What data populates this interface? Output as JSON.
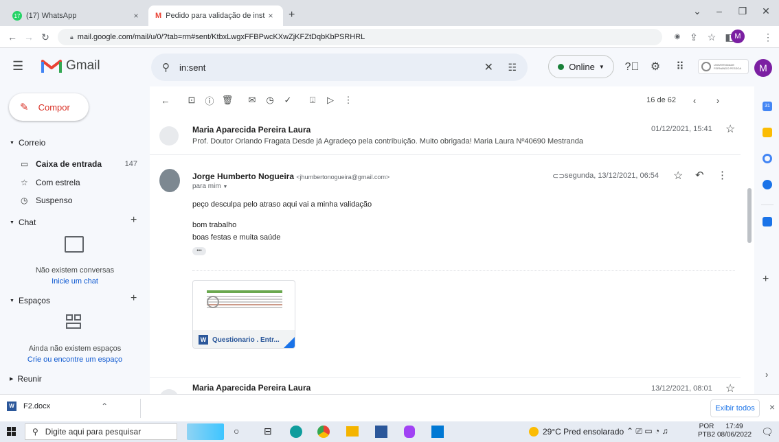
{
  "browser": {
    "tabs": [
      {
        "badge": "17",
        "label": "(17) WhatsApp",
        "close": "×"
      },
      {
        "label": "Pedido para validação de instrum",
        "close": "×"
      }
    ],
    "new_tab": "+",
    "url": "mail.google.com/mail/u/0/?tab=rm#sent/KtbxLwgxFFBPwcKXwZjKFZtDqbKbPSRHRL",
    "profile_initial": "M"
  },
  "gmail": {
    "logo_text": "Gmail",
    "search_value": "in:sent",
    "status": "Online",
    "account_initial": "M",
    "org_label": "UNIVERSIDADE FERNANDO PESSOA"
  },
  "sidebar": {
    "compose": "Compor",
    "mail_section": "Correio",
    "items": [
      {
        "label": "Caixa de entrada",
        "count": "147"
      },
      {
        "label": "Com estrela"
      },
      {
        "label": "Suspenso"
      }
    ],
    "chat_section": "Chat",
    "chat_empty": "Não existem conversas",
    "chat_link": "Inicie um chat",
    "spaces_section": "Espaços",
    "spaces_empty": "Ainda não existem espaços",
    "spaces_link": "Crie ou encontre um espaço",
    "meet_section": "Reunir"
  },
  "toolbar": {
    "counter": "16 de 62"
  },
  "messages": [
    {
      "sender": "Maria Aparecida Pereira Laura",
      "date": "01/12/2021, 15:41",
      "snippet": "Prof. Doutor Orlando Fragata Desde já Agradeço pela contribuição. Muito obrigada! Maria Laura Nº40690 Mestranda"
    },
    {
      "sender": "Jorge Humberto Nogueira",
      "email": "<jhumbertonogueira@gmail.com>",
      "date": "segunda, 13/12/2021, 06:54",
      "to": "para mim",
      "body": [
        "peço desculpa pelo atraso aqui vai a minha validação",
        "bom trabalho",
        "boas festas e muita saúde"
      ],
      "ellipsis": "•••",
      "attachment": "Questionario . Entr..."
    },
    {
      "sender": "Maria Aparecida Pereira Laura",
      "date": "13/12/2021, 08:01"
    }
  ],
  "download_bar": {
    "file": "F2.docx",
    "show_all": "Exibir todos",
    "close": "×"
  },
  "taskbar": {
    "search_placeholder": "Digite aqui para pesquisar",
    "weather": "29°C  Pred ensolarado",
    "lang": "POR",
    "lang_sub": "PTB2",
    "time": "17:49",
    "date": "08/06/2022"
  },
  "colors": {
    "gmail_red": "#ea4335",
    "online_green": "#188038",
    "link_blue": "#0b57d0",
    "word_blue": "#2b579a",
    "account_purple": "#7b1fa2"
  }
}
